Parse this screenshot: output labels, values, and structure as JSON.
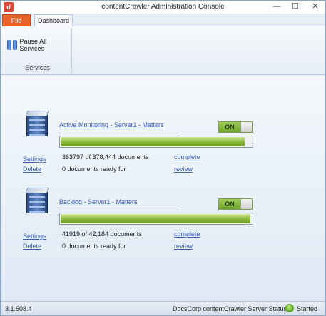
{
  "window": {
    "title": "contentCrawler Administration Console",
    "app_icon": "d",
    "minimize": "—",
    "maximize": "☐",
    "close": "✕"
  },
  "ribbon": {
    "tabs": [
      {
        "label": "File"
      },
      {
        "label": "Dashboard"
      }
    ],
    "groups": [
      {
        "label": "Services",
        "buttons": [
          {
            "label": "Pause All Services",
            "icon": "pause-icon"
          }
        ]
      }
    ]
  },
  "monitors": [
    {
      "title": "Active Monitoring - Server1 - Matters",
      "toggle_label": "ON",
      "progress": 0.962,
      "documents_text": "363797 of 378,444 documents",
      "complete_link": "complete",
      "ready_text": "0 documents ready for",
      "review_link": "review",
      "settings_link": "Settings",
      "delete_link": "Delete"
    },
    {
      "title": "Backlog - Server1 - Matters",
      "toggle_label": "ON",
      "progress": 0.994,
      "documents_text": "41919 of 42,184 documents",
      "complete_link": "complete",
      "ready_text": "0 documents ready for",
      "review_link": "review",
      "settings_link": "Settings",
      "delete_link": "Delete"
    }
  ],
  "status_bar": {
    "version": "3.1.508.4",
    "label": "DocsCorp contentCrawler Server Status",
    "value": "Started",
    "status_color": "#5da82a"
  }
}
